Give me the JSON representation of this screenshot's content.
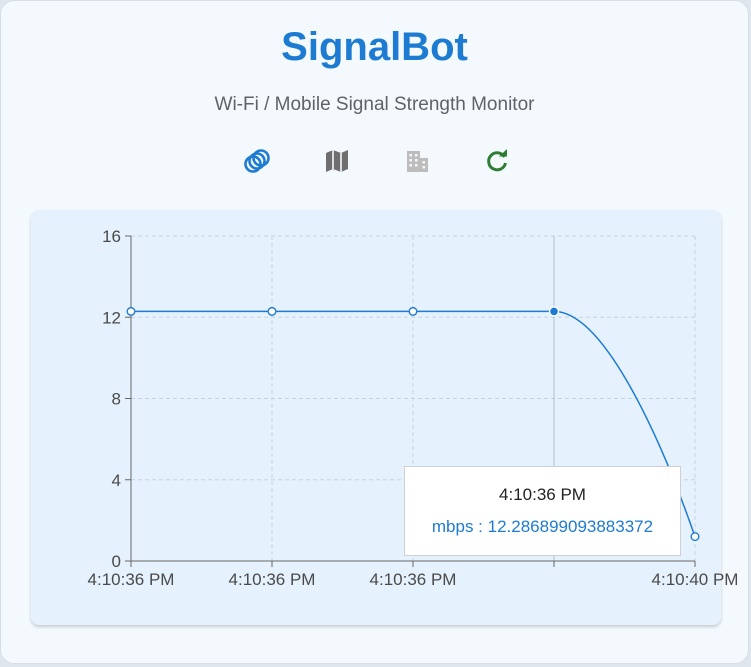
{
  "app": {
    "title": "SignalBot",
    "subtitle": "Wi-Fi / Mobile Signal Strength Monitor"
  },
  "toolbar": {
    "items": [
      {
        "icon": "rings-icon",
        "color": "#1e7bd2"
      },
      {
        "icon": "map-icon",
        "color": "#6f6f6f"
      },
      {
        "icon": "building-icon",
        "color": "#bdbdbd"
      },
      {
        "icon": "refresh-icon",
        "color": "#2e7d32"
      }
    ]
  },
  "chart_data": {
    "type": "line",
    "x": [
      "4:10:36 PM",
      "4:10:36 PM",
      "4:10:36 PM",
      "4:10:36 PM",
      "4:10:40 PM"
    ],
    "x_tick_labels": [
      "4:10:36 PM",
      "4:10:36 PM",
      "4:10:36 PM",
      "",
      "4:10:40 PM"
    ],
    "series": [
      {
        "name": "mbps",
        "values": [
          12.286899093883372,
          12.286899093883372,
          12.286899093883372,
          12.286899093883372,
          1.2
        ],
        "color": "#1e7bd2"
      }
    ],
    "ylim": [
      0,
      16
    ],
    "yticks": [
      0,
      4,
      8,
      12,
      16
    ],
    "grid": true,
    "line_color": "#1e7bd2",
    "active_index": 3
  },
  "tooltip": {
    "time": "4:10:36 PM",
    "value": "mbps : 12.286899093883372"
  }
}
